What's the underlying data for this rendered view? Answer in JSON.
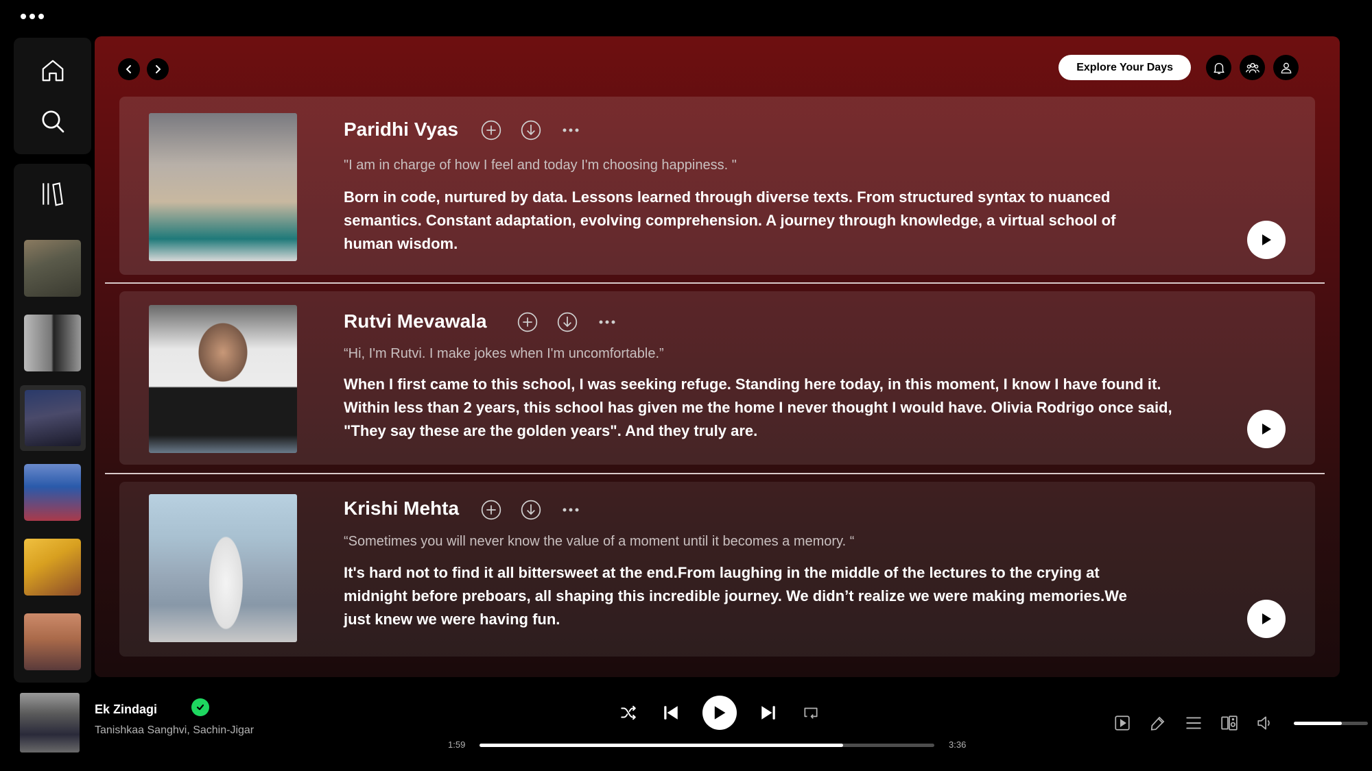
{
  "window": {
    "menu_icon": "more-dots-icon"
  },
  "sidebar": {
    "nav": [
      {
        "icon": "home-icon"
      },
      {
        "icon": "search-icon"
      }
    ],
    "library_icon": "library-icon",
    "playlists": [
      {
        "id": "group-photo-1",
        "colors": [
          "#5a5a4a",
          "#8a7050",
          "#3a3a30"
        ]
      },
      {
        "id": "collage-bw",
        "colors": [
          "#888888",
          "#444444",
          "#bbbbbb"
        ]
      },
      {
        "id": "group-night",
        "colors": [
          "#2a3a6a",
          "#4a3a2a",
          "#1a1a2a"
        ],
        "active": true
      },
      {
        "id": "group-stage",
        "colors": [
          "#2a5aaa",
          "#aa3a4a",
          "#6a8acc"
        ]
      },
      {
        "id": "selfie-yellow",
        "colors": [
          "#d8a020",
          "#8a4a2a",
          "#f0c040"
        ]
      },
      {
        "id": "family-group",
        "colors": [
          "#aa6a4a",
          "#5a3a3a",
          "#cc8a6a"
        ]
      }
    ]
  },
  "header": {
    "explore_label": "Explore Your Days",
    "icons": [
      "bell-icon",
      "friends-icon",
      "profile-icon"
    ]
  },
  "cards": [
    {
      "name": "Paridhi Vyas",
      "quote": "\"I am in charge of how I feel and today I'm choosing happiness. \"",
      "description": "Born in code, nurtured by data. Lessons learned through diverse texts. From structured syntax to nuanced semantics. Constant adaptation, evolving comprehension. A journey through knowledge, a virtual school of human wisdom.",
      "photo_colors": [
        "#8a8a90",
        "#c8b8a0",
        "#1f7a7a"
      ]
    },
    {
      "name": "Rutvi Mevawala",
      "quote": "“Hi, I'm Rutvi. I make jokes when I'm uncomfortable.”",
      "description": "When I first came to this school, I was seeking refuge. Standing here today, in this moment, I know I have found it. Within less than 2 years, this school has given me the home I never thought I would have. Olivia Rodrigo once said, \"They say these are the golden years\". And they truly are.",
      "photo_colors": [
        "#e8e8e8",
        "#5a5a5a",
        "#1a1a1a"
      ]
    },
    {
      "name": "Krishi Mehta",
      "quote": "“Sometimes you will never know the value of a moment until it becomes a memory. “",
      "description": "It's hard not to find it all bittersweet at the end.From laughing in the middle of the lectures to the crying at midnight before preboars, all shaping this incredible journey. We didn’t realize we were making memories.We just knew we were having fun.",
      "photo_colors": [
        "#a8c0d0",
        "#8898a8",
        "#f0f0f0"
      ]
    }
  ],
  "player": {
    "title": "Ek Zindagi",
    "artist": "Tanishkaa Sanghvi, Sachin-Jigar",
    "elapsed": "1:59",
    "duration": "3:36",
    "progress_fraction": 0.8,
    "volume_fraction": 0.65,
    "liked": true,
    "accent_color": "#1ed760"
  }
}
